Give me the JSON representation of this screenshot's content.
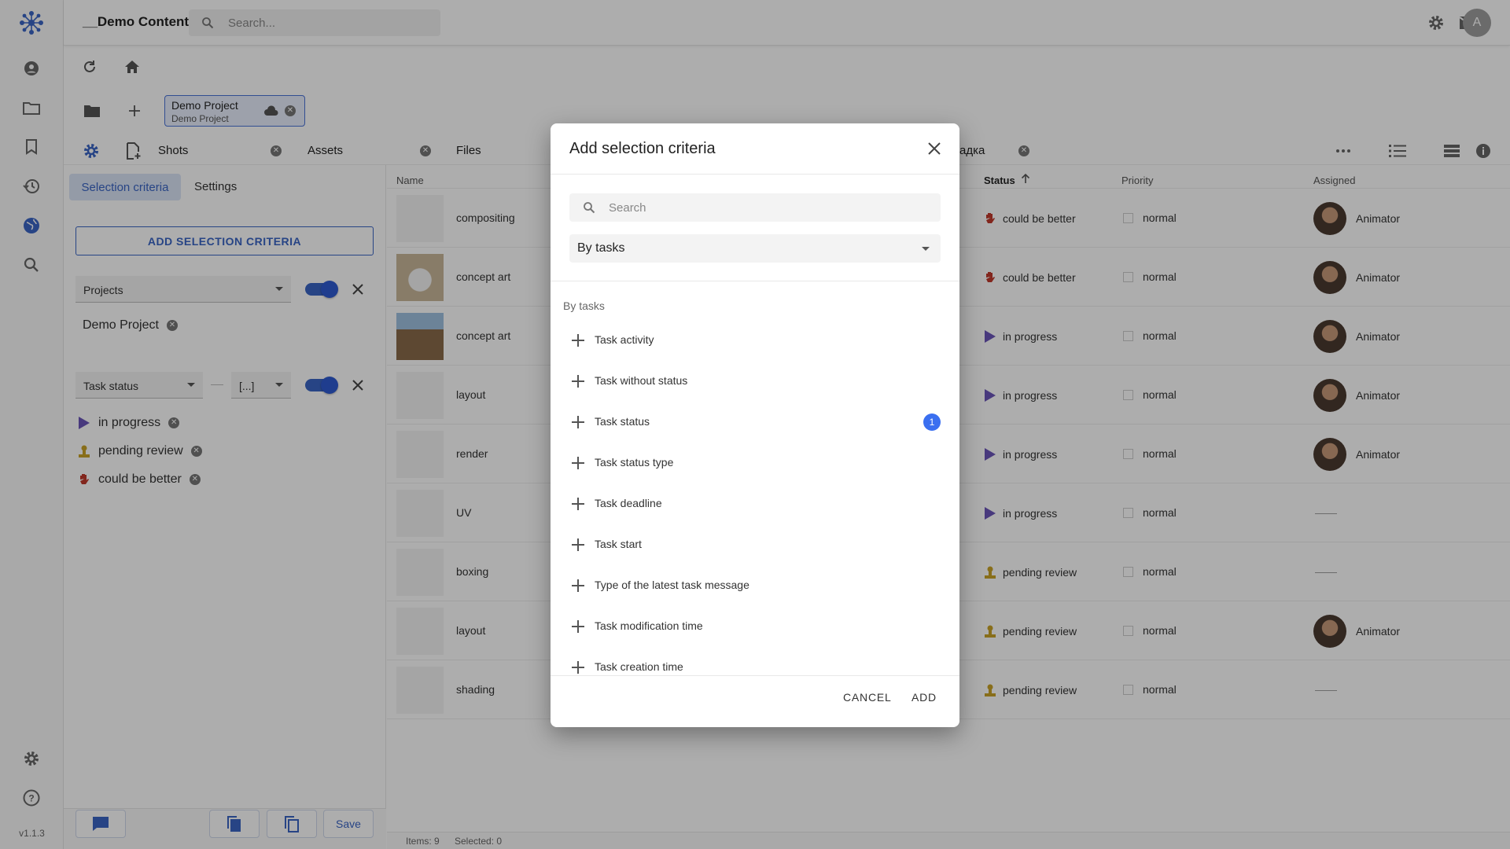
{
  "app": {
    "title": "__Demo Content",
    "version": "v1.1.3",
    "search_placeholder": "Search...",
    "avatar_letter": "A",
    "accent": "#3a65c4"
  },
  "project_chip": {
    "title": "Demo Project",
    "subtitle": "Demo Project"
  },
  "tabs": [
    {
      "label": "Shots"
    },
    {
      "label": "Assets"
    },
    {
      "label": "Files"
    },
    {
      "label": "адка"
    }
  ],
  "left_panel": {
    "seg_active": "Selection criteria",
    "seg_other": "Settings",
    "add_criteria": "ADD SELECTION CRITERIA",
    "filter1": {
      "select": "Projects",
      "chips": [
        "Demo Project"
      ]
    },
    "filter2": {
      "select": "Task status",
      "operator": "[...]",
      "chips": [
        "in progress",
        "pending review",
        "could be better"
      ]
    },
    "save_label": "Save"
  },
  "table": {
    "columns": {
      "name": "Name",
      "status": "Status",
      "priority": "Priority",
      "assigned": "Assigned"
    },
    "rows": [
      {
        "name": "compositing",
        "status": "could be better",
        "priority": "normal",
        "assigned": "Animator",
        "thumb": ""
      },
      {
        "name": "concept art",
        "status": "could be better",
        "priority": "normal",
        "assigned": "Animator",
        "thumb": "dog"
      },
      {
        "name": "concept art",
        "status": "in progress",
        "priority": "normal",
        "assigned": "Animator",
        "thumb": "castle"
      },
      {
        "name": "layout",
        "status": "in progress",
        "priority": "normal",
        "assigned": "Animator",
        "thumb": ""
      },
      {
        "name": "render",
        "status": "in progress",
        "priority": "normal",
        "assigned": "Animator",
        "thumb": ""
      },
      {
        "name": "UV",
        "status": "in progress",
        "priority": "normal",
        "assigned": "",
        "thumb": ""
      },
      {
        "name": "boxing",
        "status": "pending review",
        "priority": "normal",
        "assigned": "",
        "thumb": ""
      },
      {
        "name": "layout",
        "status": "pending review",
        "priority": "normal",
        "assigned": "Animator",
        "thumb": ""
      },
      {
        "name": "shading",
        "status": "pending review",
        "priority": "normal",
        "assigned": "",
        "thumb": ""
      }
    ],
    "empty_assigned": "——",
    "status_items": "Items: 9",
    "status_selected": "Selected: 0"
  },
  "dialog": {
    "title": "Add selection criteria",
    "search_placeholder": "Search",
    "select_value": "By tasks",
    "group_label": "By tasks",
    "items": [
      {
        "label": "Task activity",
        "badge": ""
      },
      {
        "label": "Task without status",
        "badge": ""
      },
      {
        "label": "Task status",
        "badge": "1"
      },
      {
        "label": "Task status type",
        "badge": ""
      },
      {
        "label": "Task deadline",
        "badge": ""
      },
      {
        "label": "Task start",
        "badge": ""
      },
      {
        "label": "Type of the latest task message",
        "badge": ""
      },
      {
        "label": "Task modification time",
        "badge": ""
      },
      {
        "label": "Task creation time",
        "badge": ""
      }
    ],
    "cancel": "CANCEL",
    "add": "ADD"
  }
}
